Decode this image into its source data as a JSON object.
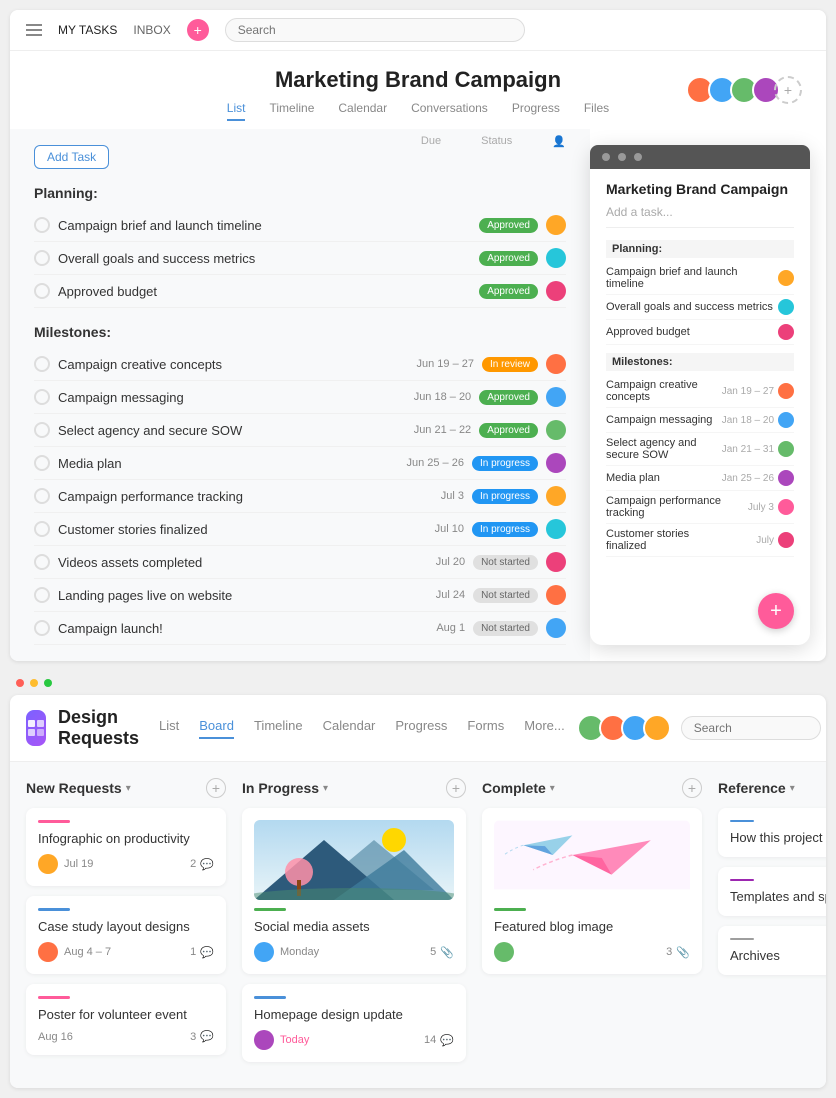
{
  "top": {
    "nav": {
      "my_tasks": "MY TASKS",
      "inbox": "INBOX",
      "search_placeholder": "Search"
    },
    "project": {
      "title": "Marketing Brand Campaign",
      "tabs": [
        "List",
        "Timeline",
        "Calendar",
        "Conversations",
        "Progress",
        "Files"
      ],
      "active_tab": "List",
      "col_headers": [
        "Due",
        "Status"
      ]
    },
    "sections": [
      {
        "title": "Planning:",
        "tasks": [
          {
            "name": "Campaign brief and launch timeline",
            "date": "",
            "badge": "Approved",
            "badge_type": "approved"
          },
          {
            "name": "Overall goals and success metrics",
            "date": "",
            "badge": "Approved",
            "badge_type": "approved"
          },
          {
            "name": "Approved budget",
            "date": "",
            "badge": "Approved",
            "badge_type": "approved"
          }
        ]
      },
      {
        "title": "Milestones:",
        "tasks": [
          {
            "name": "Campaign creative concepts",
            "date": "Jun 19 – 27",
            "badge": "In review",
            "badge_type": "review"
          },
          {
            "name": "Campaign messaging",
            "date": "Jun 18 – 20",
            "badge": "Approved",
            "badge_type": "approved"
          },
          {
            "name": "Select agency and secure SOW",
            "date": "Jun 21 – 22",
            "badge": "Approved",
            "badge_type": "approved"
          },
          {
            "name": "Media plan",
            "date": "Jun 25 – 26",
            "badge": "In progress",
            "badge_type": "progress"
          },
          {
            "name": "Campaign performance tracking",
            "date": "Jul 3",
            "badge": "In progress",
            "badge_type": "progress"
          },
          {
            "name": "Customer stories finalized",
            "date": "Jul 10",
            "badge": "In progress",
            "badge_type": "progress"
          },
          {
            "name": "Videos assets completed",
            "date": "Jul 20",
            "badge": "Not started",
            "badge_type": "notstarted"
          },
          {
            "name": "Landing pages live on website",
            "date": "Jul 24",
            "badge": "Not started",
            "badge_type": "notstarted"
          },
          {
            "name": "Campaign launch!",
            "date": "Aug 1",
            "badge": "Not started",
            "badge_type": "notstarted"
          }
        ]
      }
    ],
    "add_task_label": "Add Task",
    "panel": {
      "title": "Marketing Brand Campaign",
      "add_placeholder": "Add a task...",
      "sections": [
        {
          "title": "Planning:",
          "tasks": [
            {
              "name": "Campaign brief and launch timeline",
              "date": ""
            },
            {
              "name": "Overall goals and success metrics",
              "date": ""
            },
            {
              "name": "Approved budget",
              "date": ""
            }
          ]
        },
        {
          "title": "Milestones:",
          "tasks": [
            {
              "name": "Campaign creative concepts",
              "date": "Jan 19 – 27"
            },
            {
              "name": "Campaign messaging",
              "date": "Jan 18 – 20"
            },
            {
              "name": "Select agency and secure SOW",
              "date": "Jan 21 – 31"
            },
            {
              "name": "Media plan",
              "date": "Jan 25 – 26"
            },
            {
              "name": "Campaign performance tracking",
              "date": "July 3"
            },
            {
              "name": "Customer stories finalized",
              "date": "July"
            }
          ]
        }
      ]
    }
  },
  "bottom": {
    "app_icon": "▣",
    "project_name": "Design Requests",
    "tabs": [
      "List",
      "Board",
      "Timeline",
      "Calendar",
      "Progress",
      "Forms",
      "More..."
    ],
    "active_tab": "Board",
    "search_placeholder": "Search",
    "columns": [
      {
        "id": "new-requests",
        "title": "New Requests",
        "cards": [
          {
            "id": "infographic",
            "accent": "pink",
            "title": "Infographic on productivity",
            "date": "Jul 19",
            "comments": "2",
            "has_avatar": true
          },
          {
            "id": "case-study",
            "accent": "blue",
            "title": "Case study layout designs",
            "date": "Aug 4 – 7",
            "comments": "1",
            "has_avatar": true
          },
          {
            "id": "poster",
            "accent": "pink",
            "title": "Poster for volunteer event",
            "date": "Aug 16",
            "comments": "3",
            "has_avatar": false
          }
        ]
      },
      {
        "id": "in-progress",
        "title": "In Progress",
        "cards": [
          {
            "id": "social-media",
            "accent": "green",
            "title": "Social media assets",
            "date": "Monday",
            "comments": "5",
            "has_image": true,
            "image_type": "mountain"
          },
          {
            "id": "homepage",
            "accent": "blue",
            "title": "Homepage design update",
            "date": "Today",
            "date_color": "#ff5b9a",
            "comments": "14",
            "has_avatar": true
          }
        ]
      },
      {
        "id": "complete",
        "title": "Complete",
        "cards": [
          {
            "id": "featured-blog",
            "accent": "green",
            "title": "Featured blog image",
            "date": "",
            "comments": "3",
            "has_image": true,
            "image_type": "plane"
          }
        ]
      },
      {
        "id": "reference",
        "title": "Reference",
        "ref_cards": [
          {
            "id": "how-project-works",
            "color": "#4a90d9",
            "title": "How this project works"
          },
          {
            "id": "templates-specs",
            "color": "#9C27B0",
            "title": "Templates and specs"
          },
          {
            "id": "archives",
            "color": "#9e9e9e",
            "title": "Archives"
          }
        ]
      }
    ]
  }
}
